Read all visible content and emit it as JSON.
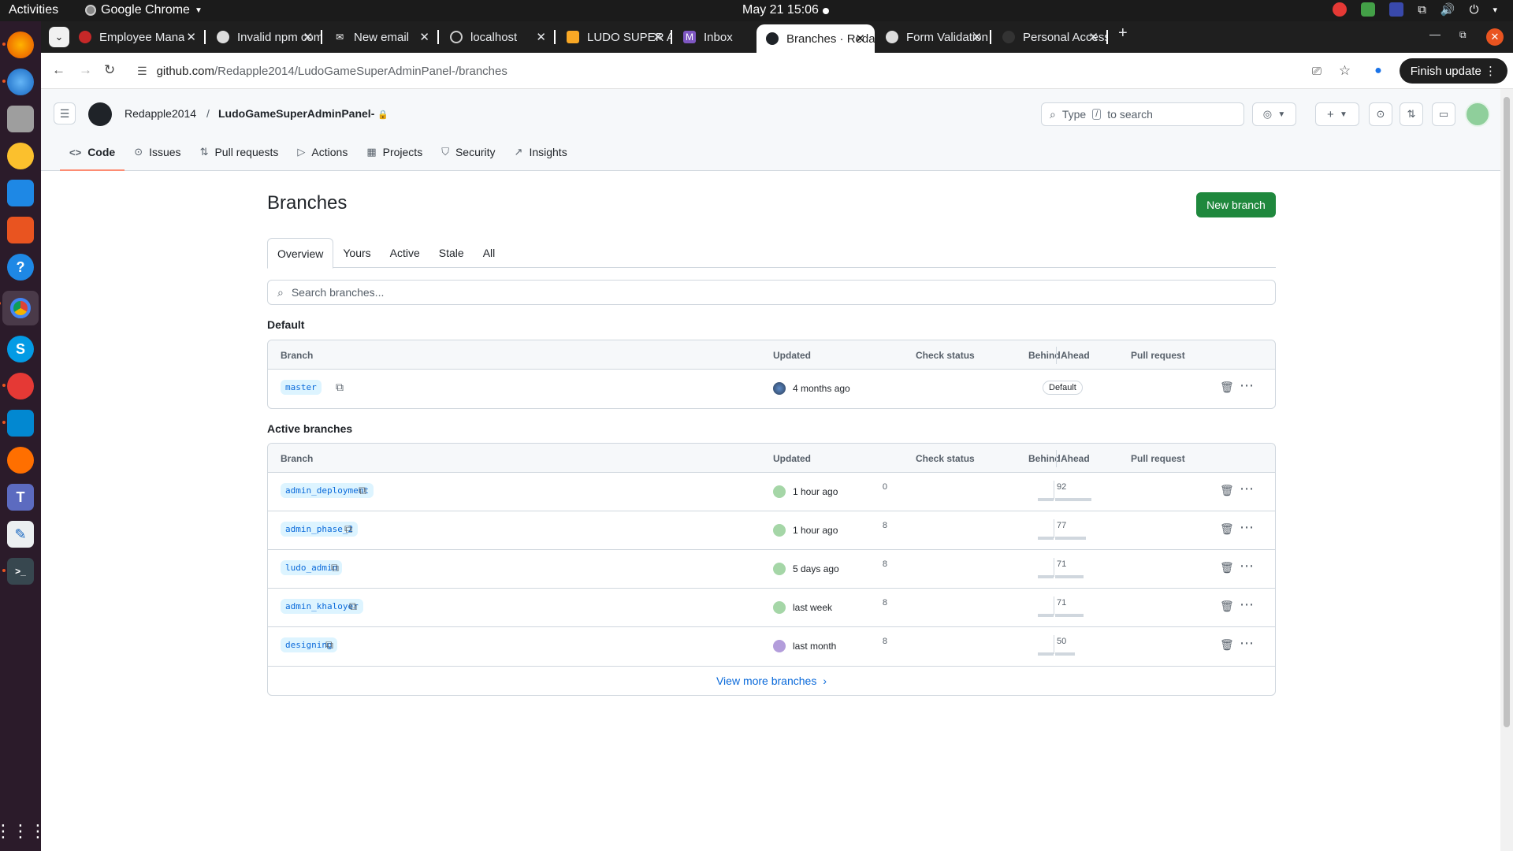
{
  "system": {
    "activities": "Activities",
    "app_name": "Google Chrome",
    "clock": "May 21  15:06"
  },
  "dock": {
    "items": [
      "firefox-icon",
      "thunderbird-icon",
      "files-icon",
      "rhythmbox-icon",
      "writer-icon",
      "app-center-icon",
      "help-icon",
      "chrome-icon",
      "skype-icon",
      "screenshot-icon",
      "vscode-icon",
      "postman-icon",
      "teams-icon",
      "text-editor-icon",
      "terminal-icon"
    ]
  },
  "tabs": [
    {
      "label": "Employee Mana",
      "active": false
    },
    {
      "label": "Invalid npm com",
      "active": false
    },
    {
      "label": "New email",
      "active": false
    },
    {
      "label": "localhost",
      "active": false
    },
    {
      "label": "LUDO SUPER AD",
      "active": false
    },
    {
      "label": "Inbox",
      "active": false
    },
    {
      "label": "Branches · Reda",
      "active": true
    },
    {
      "label": "Form Validation",
      "active": false
    },
    {
      "label": "Personal Access",
      "active": false
    }
  ],
  "omnibox": {
    "domain": "github.com",
    "path": "/Redapple2014/LudoGameSuperAdminPanel-/branches"
  },
  "toolbar": {
    "finish_update": "Finish update"
  },
  "header": {
    "owner": "Redapple2014",
    "slash": "/",
    "repo": "LudoGameSuperAdminPanel-",
    "search_type": "Type",
    "search_key": "/",
    "search_suffix": "to search"
  },
  "repo_nav": [
    {
      "label": "Code",
      "icon": "code-icon",
      "selected": true
    },
    {
      "label": "Issues",
      "icon": "issue-icon",
      "selected": false
    },
    {
      "label": "Pull requests",
      "icon": "pull-request-icon",
      "selected": false
    },
    {
      "label": "Actions",
      "icon": "play-icon",
      "selected": false
    },
    {
      "label": "Projects",
      "icon": "table-icon",
      "selected": false
    },
    {
      "label": "Security",
      "icon": "shield-icon",
      "selected": false
    },
    {
      "label": "Insights",
      "icon": "graph-icon",
      "selected": false
    }
  ],
  "page": {
    "title": "Branches",
    "new_branch": "New branch",
    "tabs": [
      "Overview",
      "Yours",
      "Active",
      "Stale",
      "All"
    ],
    "search_placeholder": "Search branches...",
    "default_heading": "Default",
    "active_heading": "Active branches",
    "columns": {
      "branch": "Branch",
      "updated": "Updated",
      "check_status": "Check status",
      "behind": "Behind",
      "ahead": "Ahead",
      "pull_request": "Pull request"
    },
    "default_branch": {
      "name": "master",
      "updated": "4 months ago",
      "badge": "Default"
    },
    "active_branches": [
      {
        "name": "admin_deployment",
        "updated": "1 hour ago",
        "behind": "0",
        "ahead": "92"
      },
      {
        "name": "admin_phase_2",
        "updated": "1 hour ago",
        "behind": "8",
        "ahead": "77"
      },
      {
        "name": "ludo_admin",
        "updated": "5 days ago",
        "behind": "8",
        "ahead": "71"
      },
      {
        "name": "admin_khaloyer",
        "updated": "last week",
        "behind": "8",
        "ahead": "71"
      },
      {
        "name": "designing",
        "updated": "last month",
        "behind": "8",
        "ahead": "50"
      }
    ],
    "view_more": "View more branches"
  },
  "colors": {
    "accent_green": "#1f883d",
    "link_blue": "#0969da",
    "nav_underline": "#fd8c73",
    "ubuntu_orange": "#e95420"
  }
}
